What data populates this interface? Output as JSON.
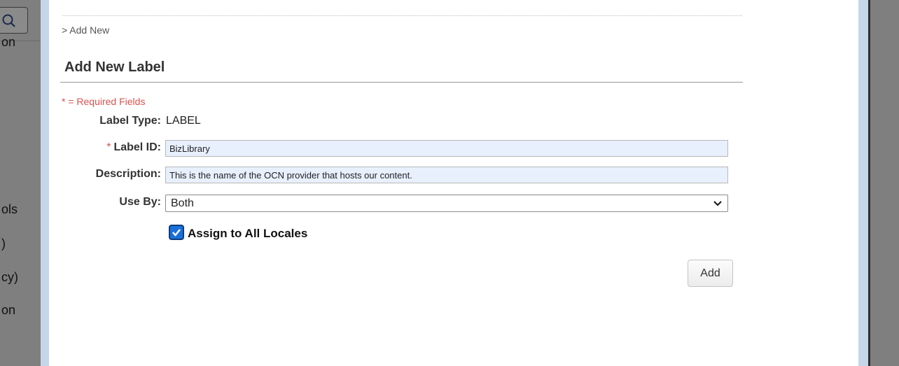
{
  "background_left": {
    "fragments": [
      "on",
      "ols",
      ")",
      "cy)",
      "on"
    ]
  },
  "breadcrumb": "> Add New",
  "page": {
    "title": "Add New Label",
    "required_note": "* = Required Fields"
  },
  "form": {
    "label_type": {
      "label": "Label Type:",
      "value": "LABEL"
    },
    "label_id": {
      "required_mark": "*",
      "label": "Label ID:",
      "value": "BizLibrary"
    },
    "description": {
      "label": "Description:",
      "value": "This is the name of the OCN provider that hosts our content."
    },
    "use_by": {
      "label": "Use By:",
      "selected": "Both"
    },
    "assign_all_locales": {
      "label": "Assign to All Locales",
      "checked": true
    },
    "add_label": "Add"
  },
  "colors": {
    "required": "#d9534f",
    "checkbox": "#1a6fdc",
    "input_fill": "#e8f0fe",
    "side_bar": "#c5d6e8",
    "backdrop": "#7f7f7f"
  },
  "icons": [
    "search-icon",
    "chevron-down-icon",
    "checkmark-icon"
  ]
}
